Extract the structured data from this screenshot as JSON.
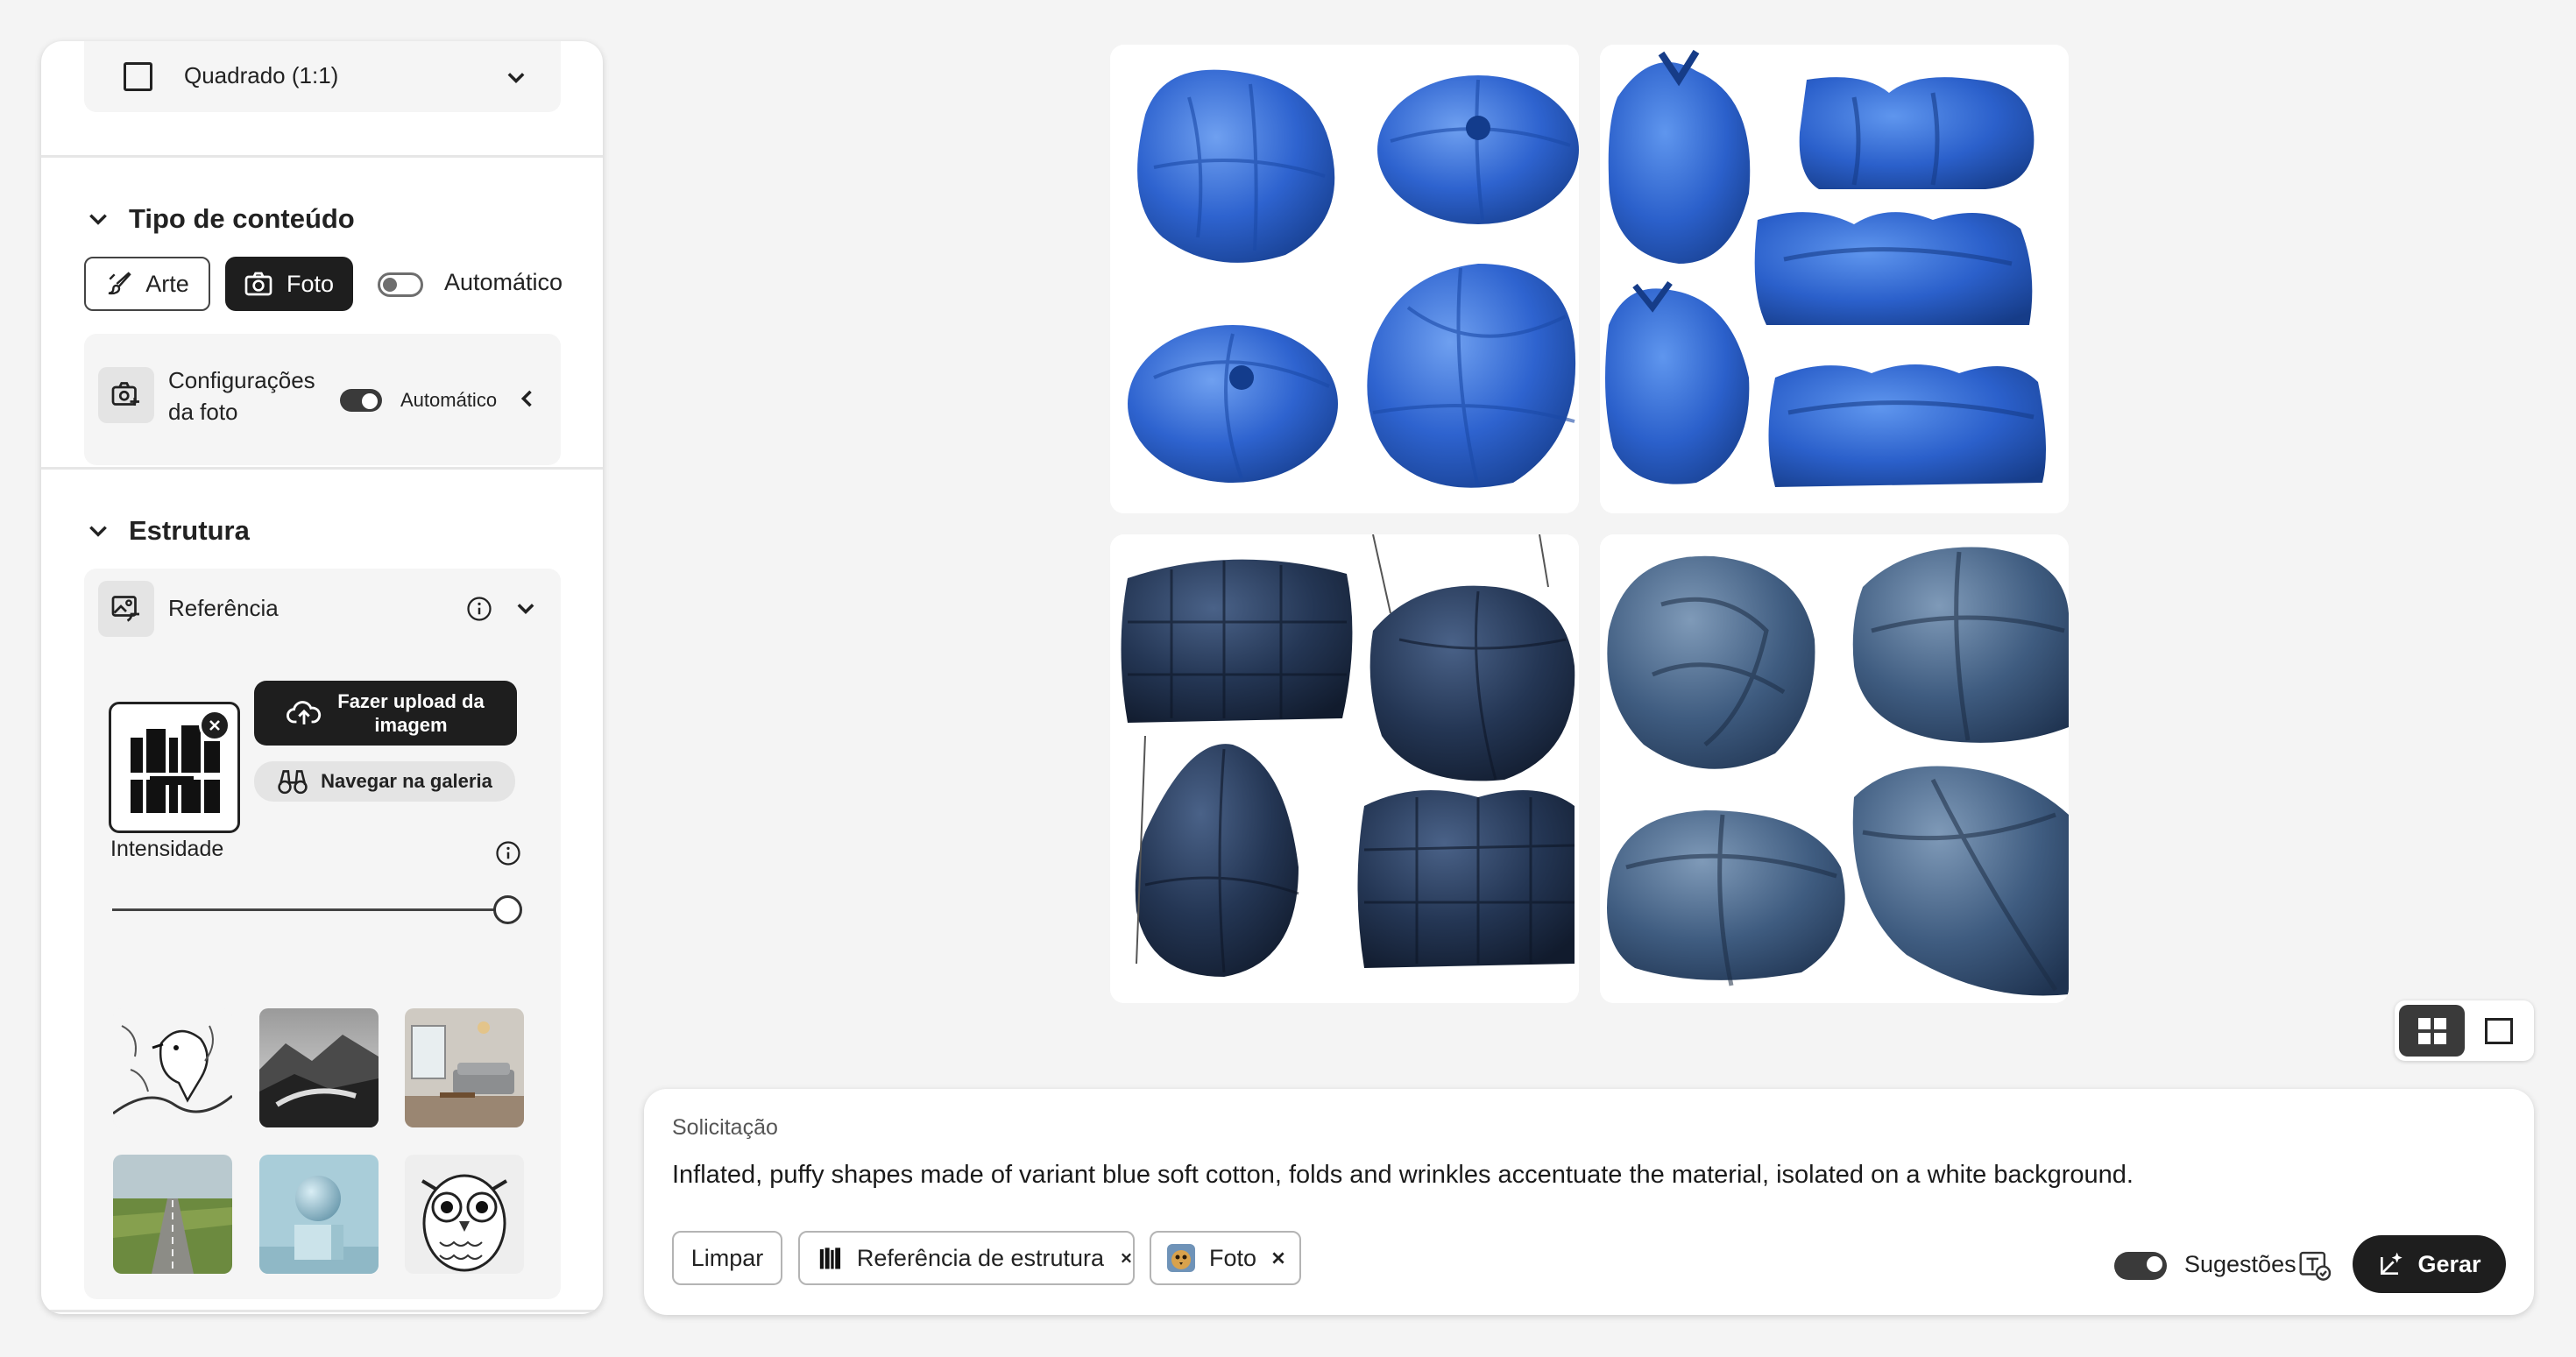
{
  "sidebar": {
    "aspect_ratio": {
      "label": "Quadrado (1:1)"
    },
    "content_type": {
      "title": "Tipo de conteúdo",
      "art_label": "Arte",
      "photo_label": "Foto",
      "auto_label": "Automático",
      "auto_enabled": false,
      "photo_settings": {
        "label_line1": "Configurações",
        "label_line2": "da foto",
        "auto_label": "Automático",
        "auto_enabled": true
      }
    },
    "structure": {
      "title": "Estrutura",
      "reference_label": "Referência",
      "upload_line1": "Fazer upload da",
      "upload_line2": "imagem",
      "browse_gallery_label": "Navegar na galeria",
      "intensity_label": "Intensidade",
      "intensity_value": 1.0,
      "presets": [
        "sketch-bird",
        "misty-mountains",
        "living-room",
        "rural-road",
        "sphere-on-cube",
        "owl-sketch"
      ]
    }
  },
  "gallery": {
    "images": [
      "blue-puffy-shapes-1",
      "blue-puffy-shapes-2",
      "navy-puffy-shapes-3",
      "steel-blue-puffy-shapes-4"
    ],
    "view_modes": [
      "grid",
      "single"
    ],
    "active_view": "grid"
  },
  "prompt": {
    "label": "Solicitação",
    "text": "Inflated, puffy shapes made of variant blue soft cotton, folds and wrinkles accentuate the material, isolated on a white background.",
    "clear_label": "Limpar",
    "tags": [
      {
        "label": "Referência de estrutura"
      },
      {
        "label": "Foto"
      }
    ],
    "suggestions_label": "Sugestões",
    "suggestions_enabled": true,
    "generate_label": "Gerar"
  },
  "colors": {
    "accent_dark": "#1e1e1e",
    "cotton_blue": "#2f64c6",
    "navy": "#1e2b45"
  }
}
